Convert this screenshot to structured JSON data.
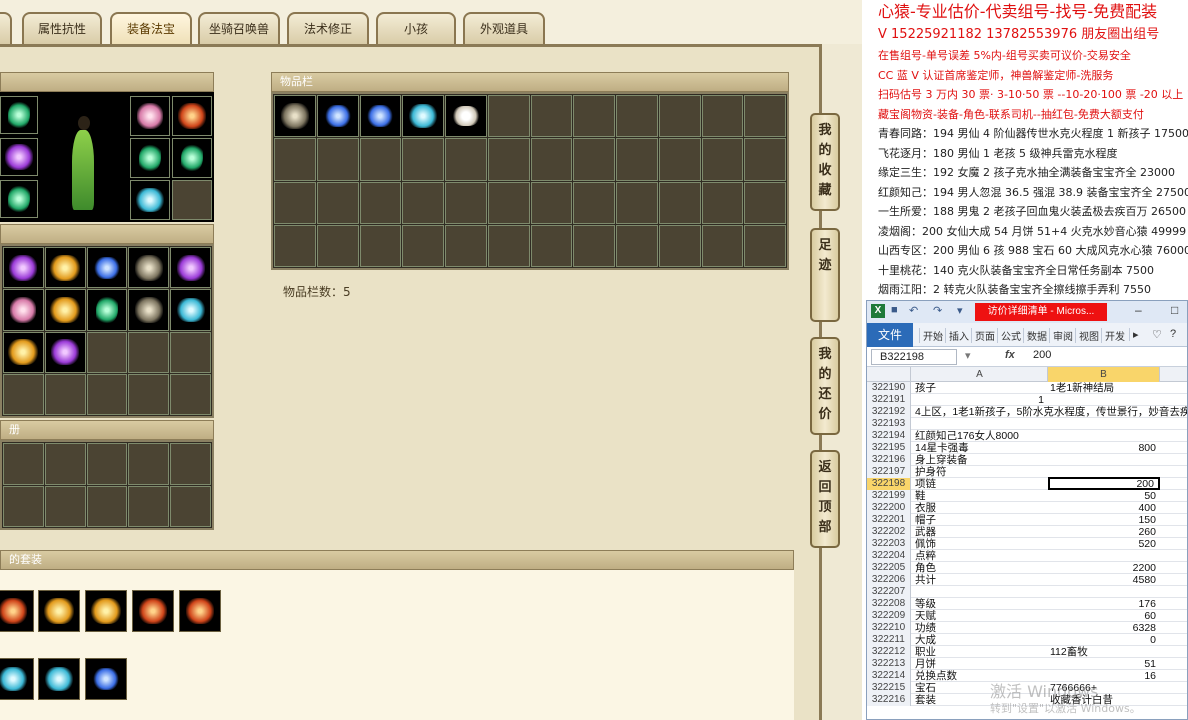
{
  "game": {
    "tabs": [
      {
        "label": "属性抗性",
        "active": false
      },
      {
        "label": "装备法宝",
        "active": true
      },
      {
        "label": "坐骑召唤兽",
        "active": false
      },
      {
        "label": "法术修正",
        "active": false
      },
      {
        "label": "小孩",
        "active": false
      },
      {
        "label": "外观道具",
        "active": false
      }
    ],
    "inventory": {
      "title": "物品栏",
      "count_label": "物品栏数：5"
    },
    "sections": {
      "book_suffix": "册",
      "suit_suffix": "的套装"
    },
    "side_buttons": [
      "我的收藏",
      "足迹",
      "我的还价",
      "返回顶部"
    ],
    "equip_icons": [
      "bag-icon",
      "armor-icon",
      "boots-icon",
      "fan-icon",
      "ring-icon",
      "gem-icon",
      "gem-icon",
      "cloud-icon"
    ],
    "inventory_items": [
      "boots-icon",
      "blue-gem-icon",
      "blue-gem-icon",
      "green-stone-icon",
      "white-pearl-icon"
    ]
  },
  "ads": {
    "lines": [
      {
        "text": "心猿-专业估价-代卖组号-找号-免费配装",
        "style": "red big"
      },
      {
        "text": "V 15225921182   13782553976 朋友圈出组号",
        "style": "red mid"
      },
      {
        "text": "在售组号-单号误差 5%内-组号买卖可议价-交易安全",
        "style": "red"
      },
      {
        "text": "CC 蓝 V 认证首席鉴定师，神兽解鉴定师-洗服务",
        "style": "red"
      },
      {
        "text": "扫码估号 3 万内 30 票· 3-10·50 票 --10-20·100 票 -20 以上 150",
        "style": "red"
      },
      {
        "text": "藏宝阁物资-装备-角色-联系司机--抽红包-免费大额支付",
        "style": "red"
      },
      {
        "text": "青春同路：194 男仙 4 阶仙器传世水克火程度 1 新孩子 175000",
        "style": ""
      },
      {
        "text": "飞花逐月：180 男仙 1 老孩 5 级神兵雷克水程度",
        "style": ""
      },
      {
        "text": "缘定三生：192 女魔 2 孩子克水抽全满装备宝宝齐全 23000",
        "style": ""
      },
      {
        "text": "红颜知己：194 男人忽混 36.5 强混 38.9 装备宝宝齐全 27500",
        "style": ""
      },
      {
        "text": "一生所爱：188 男鬼 2 老孩子回血鬼火装孟极去疾百万 26500",
        "style": ""
      },
      {
        "text": "凌烟阁：200 女仙大成 54 月饼 51+4 火克水妙音心猿 49999",
        "style": ""
      },
      {
        "text": "山西专区：200 男仙 6 孩 988 宝石 60 大成风克水心猿 76000",
        "style": ""
      },
      {
        "text": "十里桃花：140 克火队装备宝宝齐全日常任务副本 7500",
        "style": ""
      },
      {
        "text": "烟雨江阳：2 转克火队装备宝宝齐全擦线擦手弄利 7550",
        "style": ""
      }
    ]
  },
  "excel": {
    "doc_title": "访价详细清单 - Micros...",
    "file_tab": "文件",
    "ribbon_tabs": [
      "开始",
      "插入",
      "页面",
      "公式",
      "数据",
      "审阅",
      "视图",
      "开发"
    ],
    "name_box": "B322198",
    "fx": "fx",
    "formula_value": "200",
    "col_a": "A",
    "col_b": "B",
    "rows": [
      {
        "n": "322190",
        "a": "孩子",
        "b": "1老1新神结局",
        "bt": "txt"
      },
      {
        "n": "322191",
        "a": "",
        "b": "",
        "a_num": "1"
      },
      {
        "n": "322192",
        "a": "4上区，1老1新孩子，5阶水克水程度，传世景行，妙音去疾",
        "b": ""
      },
      {
        "n": "322193",
        "a": "",
        "b": ""
      },
      {
        "n": "322194",
        "a": "红颜知己176女人8000",
        "b": ""
      },
      {
        "n": "322195",
        "a": "14星卡强毒",
        "b": "800",
        "bt": "num"
      },
      {
        "n": "322196",
        "a": "身上穿装备",
        "b": ""
      },
      {
        "n": "322197",
        "a": "护身符",
        "b": ""
      },
      {
        "n": "322198",
        "a": "项链",
        "b": "200",
        "bt": "num",
        "sel": true
      },
      {
        "n": "322199",
        "a": "鞋",
        "b": "50",
        "bt": "num"
      },
      {
        "n": "322200",
        "a": "衣服",
        "b": "400",
        "bt": "num"
      },
      {
        "n": "322201",
        "a": "帽子",
        "b": "150",
        "bt": "num"
      },
      {
        "n": "322202",
        "a": "武器",
        "b": "260",
        "bt": "num"
      },
      {
        "n": "322203",
        "a": "佩饰",
        "b": "520",
        "bt": "num"
      },
      {
        "n": "322204",
        "a": "点粹",
        "b": ""
      },
      {
        "n": "322205",
        "a": "角色",
        "b": "2200",
        "bt": "num"
      },
      {
        "n": "322206",
        "a": "共计",
        "b": "4580",
        "bt": "num"
      },
      {
        "n": "322207",
        "a": "",
        "b": ""
      },
      {
        "n": "322208",
        "a": "等级",
        "b": "176",
        "bt": "num"
      },
      {
        "n": "322209",
        "a": "天赋",
        "b": "60",
        "bt": "num"
      },
      {
        "n": "322210",
        "a": "功绩",
        "b": "6328",
        "bt": "num"
      },
      {
        "n": "322211",
        "a": "大成",
        "b": "0",
        "bt": "num"
      },
      {
        "n": "322212",
        "a": "职业",
        "b": "112畜牧",
        "bt": "txt"
      },
      {
        "n": "322213",
        "a": "月饼",
        "b": "51",
        "bt": "num"
      },
      {
        "n": "322214",
        "a": "兑换点数",
        "b": "16",
        "bt": "num"
      },
      {
        "n": "322215",
        "a": "宝石",
        "b": "7766666+",
        "bt": "txt"
      },
      {
        "n": "322216",
        "a": "套装",
        "b": "收藏香计白昔",
        "bt": "txt"
      }
    ]
  },
  "watermark": {
    "line1": "激活 Windows",
    "line2": "转到\"设置\"以激活 Windows。"
  }
}
